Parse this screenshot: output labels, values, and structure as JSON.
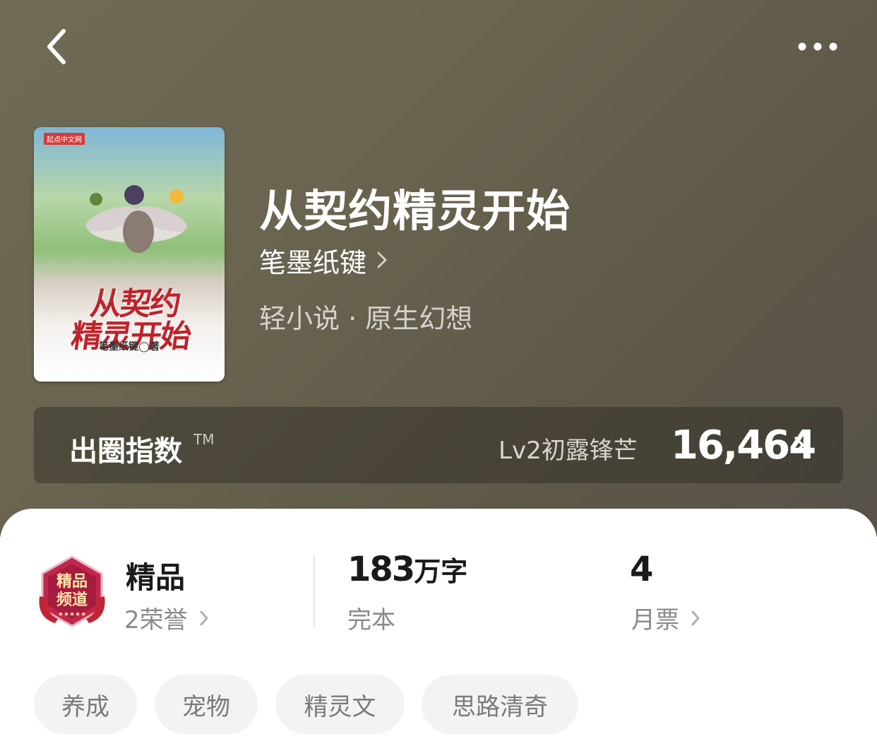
{
  "header": {
    "back_icon": "chevron-left-icon",
    "more_icon": "more-horizontal-icon"
  },
  "book": {
    "cover": {
      "brand": "起点中文网",
      "title_line1": "从契约",
      "title_line2": "精灵开始",
      "author_line": "笔墨纸键◯著"
    },
    "title": "从契约精灵开始",
    "author": "笔墨纸键",
    "genre": "轻小说 · 原生幻想"
  },
  "index": {
    "label": "出圈指数",
    "tm": "TM",
    "level": "Lv2初露锋芒",
    "score": "16,464"
  },
  "stats": {
    "quality": {
      "badge_text": "精品频道",
      "title": "精品",
      "sub": "2荣誉"
    },
    "words": {
      "number": "183",
      "unit": "万字",
      "sub": "完本"
    },
    "tickets": {
      "number": "4",
      "sub": "月票"
    }
  },
  "tags": [
    "养成",
    "宠物",
    "精灵文",
    "思路清奇"
  ],
  "colors": {
    "hero_bg": "#6a6450",
    "badge_red": "#c2264b",
    "tag_bg": "#f3f3f3"
  }
}
